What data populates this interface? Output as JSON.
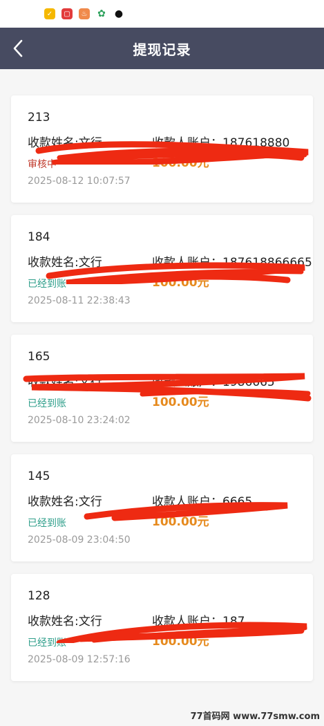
{
  "status_bar": {
    "icons": [
      "app-yellow-icon",
      "app-red-icon",
      "app-orange-icon",
      "app-green-icon",
      "qq-penguin-icon"
    ]
  },
  "header": {
    "back_icon": "chevron-left-icon",
    "title": "提现记录"
  },
  "records": [
    {
      "id": "213",
      "name_label": "收款姓名:文行",
      "account_label": "收款人账户：187618880",
      "status": "审核中",
      "amount": "100.00元",
      "time": "2025-08-12 10:07:57"
    },
    {
      "id": "184",
      "name_label": "收款姓名:文行",
      "account_label": "收款人账户：187618866665",
      "status": "已经到账",
      "amount": "100.00元",
      "time": "2025-08-11 22:38:43"
    },
    {
      "id": "165",
      "name_label": "收款姓名:文行",
      "account_label": "收款人账户：1986665",
      "status": "已经到账",
      "amount": "100.00元",
      "time": "2025-08-10 23:24:02"
    },
    {
      "id": "145",
      "name_label": "收款姓名:文行",
      "account_label": "收款人账户：6665",
      "status": "已经到账",
      "amount": "100.00元",
      "time": "2025-08-09 23:04:50"
    },
    {
      "id": "128",
      "name_label": "收款姓名:文行",
      "account_label": "收款人账户：187",
      "status": "已经到账",
      "amount": "100.00元",
      "time": "2025-08-09 12:57:16"
    }
  ],
  "colors": {
    "header_bg": "#474b61",
    "status_pending": "#c0392b",
    "status_done": "#2e9e8a",
    "amount": "#e68a1e",
    "redaction": "#ee2a12"
  },
  "watermark": "77首码网 www.77smw.com"
}
